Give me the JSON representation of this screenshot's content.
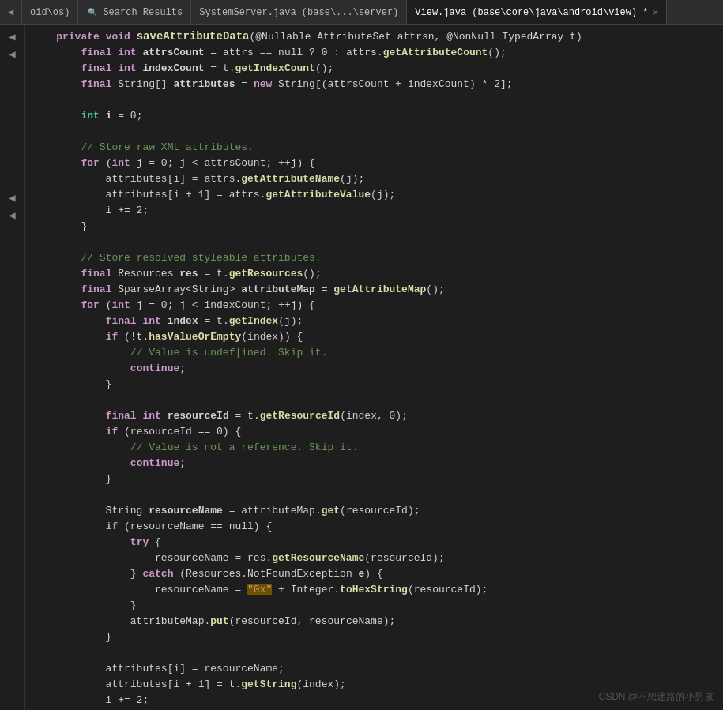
{
  "tabs": [
    {
      "id": "android-os",
      "label": "oid\\os)",
      "active": false,
      "closable": false
    },
    {
      "id": "search-results",
      "label": "Search Results",
      "active": false,
      "closable": false,
      "icon": "🔍"
    },
    {
      "id": "system-server",
      "label": "SystemServer.java (base\\...\\server)",
      "active": false,
      "closable": false
    },
    {
      "id": "view-java",
      "label": "View.java (base\\core\\java\\android\\view) *",
      "active": true,
      "closable": true
    }
  ],
  "watermark": "CSDN @不想迷路的小男孩",
  "code_lines": []
}
